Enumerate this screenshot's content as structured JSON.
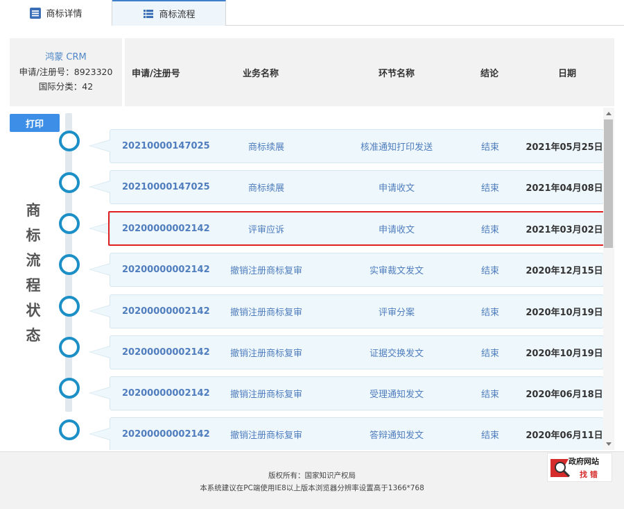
{
  "tabs": [
    {
      "label": "商标详情",
      "icon": "document-list-icon"
    },
    {
      "label": "商标流程",
      "icon": "table-list-icon"
    }
  ],
  "info": {
    "brand": "鸿蒙 CRM",
    "reg_line": "申请/注册号：8923320",
    "class_line": "国际分类：42"
  },
  "columns": [
    "申请/注册号",
    "业务名称",
    "环节名称",
    "结论",
    "日期"
  ],
  "print_label": "打印",
  "side_title": [
    "商",
    "标",
    "流",
    "程",
    "状",
    "态"
  ],
  "rows": [
    {
      "reg": "20210000147025",
      "biz": "商标续展",
      "step": "核准通知打印发送",
      "con": "结束",
      "date": "2021年05月25日"
    },
    {
      "reg": "20210000147025",
      "biz": "商标续展",
      "step": "申请收文",
      "con": "结束",
      "date": "2021年04月08日"
    },
    {
      "reg": "20200000002142",
      "biz": "评审应诉",
      "step": "申请收文",
      "con": "结束",
      "date": "2021年03月02日"
    },
    {
      "reg": "20200000002142",
      "biz": "撤销注册商标复审",
      "step": "实审裁文发文",
      "con": "结束",
      "date": "2020年12月15日"
    },
    {
      "reg": "20200000002142",
      "biz": "撤销注册商标复审",
      "step": "评审分案",
      "con": "结束",
      "date": "2020年10月19日"
    },
    {
      "reg": "20200000002142",
      "biz": "撤销注册商标复审",
      "step": "证据交换发文",
      "con": "结束",
      "date": "2020年10月19日"
    },
    {
      "reg": "20200000002142",
      "biz": "撤销注册商标复审",
      "step": "受理通知发文",
      "con": "结束",
      "date": "2020年06月18日"
    },
    {
      "reg": "20200000002142",
      "biz": "撤销注册商标复审",
      "step": "答辩通知发文",
      "con": "结束",
      "date": "2020年06月11日"
    }
  ],
  "footer": {
    "line1": "版权所有：国家知识产权局",
    "line2": "本系统建议在PC端使用IE8以上版本浏览器分辨率设置高于1366*768"
  },
  "badge": {
    "line1": "政府网站",
    "line2": "找 错"
  },
  "colors": {
    "accent": "#3d8ee6",
    "dot": "#1c8fc6",
    "link": "#4f7dbe",
    "highlight": "#e02020"
  }
}
